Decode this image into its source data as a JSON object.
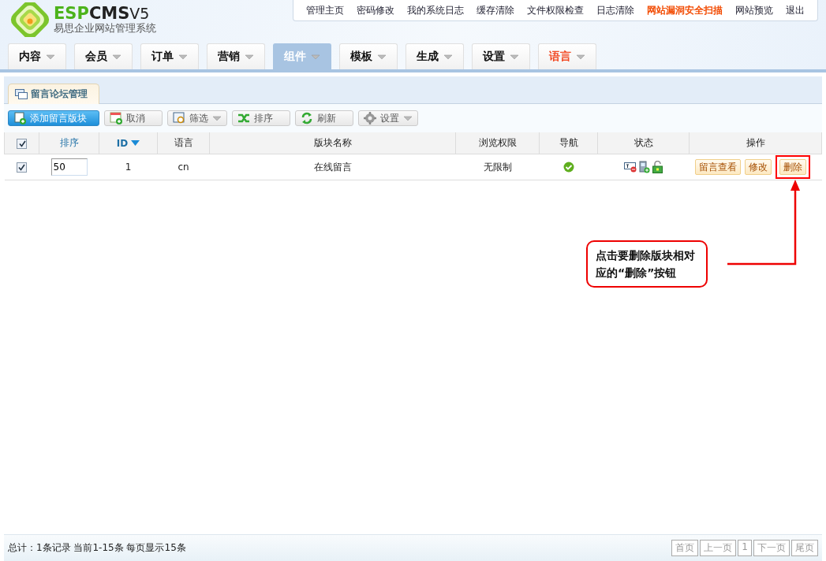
{
  "logo": {
    "brand_prefix": "ESP",
    "brand_name": "CMS",
    "version": "V5",
    "subtitle": "易思企业网站管理系统"
  },
  "top_links": [
    {
      "label": "管理主页",
      "highlight": false
    },
    {
      "label": "密码修改",
      "highlight": false
    },
    {
      "label": "我的系统日志",
      "highlight": false
    },
    {
      "label": "缓存清除",
      "highlight": false
    },
    {
      "label": "文件权限检查",
      "highlight": false
    },
    {
      "label": "日志清除",
      "highlight": false
    },
    {
      "label": "网站漏洞安全扫描",
      "highlight": true
    },
    {
      "label": "网站预览",
      "highlight": false
    },
    {
      "label": "退出",
      "highlight": false
    }
  ],
  "nav_tabs": [
    {
      "label": "内容",
      "selected": false,
      "highlight": false
    },
    {
      "label": "会员",
      "selected": false,
      "highlight": false
    },
    {
      "label": "订单",
      "selected": false,
      "highlight": false
    },
    {
      "label": "营销",
      "selected": false,
      "highlight": false
    },
    {
      "label": "组件",
      "selected": true,
      "highlight": false
    },
    {
      "label": "模板",
      "selected": false,
      "highlight": false
    },
    {
      "label": "生成",
      "selected": false,
      "highlight": false
    },
    {
      "label": "设置",
      "selected": false,
      "highlight": false
    },
    {
      "label": "语言",
      "selected": false,
      "highlight": true
    }
  ],
  "panel_tab": "留言论坛管理",
  "toolbar": [
    {
      "label": "添加留言版块",
      "kind": "primary",
      "dropdown": false
    },
    {
      "label": "取消",
      "kind": "plain",
      "dropdown": false
    },
    {
      "label": "筛选",
      "kind": "plain",
      "dropdown": true
    },
    {
      "label": "排序",
      "kind": "plain",
      "dropdown": false
    },
    {
      "label": "刷新",
      "kind": "plain",
      "dropdown": false
    },
    {
      "label": "设置",
      "kind": "plain",
      "dropdown": true
    }
  ],
  "table": {
    "select_all": {
      "checked": true
    },
    "columns": [
      {
        "label": "排序",
        "link": true,
        "sorted": false
      },
      {
        "label": "ID",
        "link": true,
        "sorted": true
      },
      {
        "label": "语言",
        "link": false,
        "sorted": false
      },
      {
        "label": "版块名称",
        "link": false,
        "sorted": false
      },
      {
        "label": "浏览权限",
        "link": false,
        "sorted": false
      },
      {
        "label": "导航",
        "link": false,
        "sorted": false
      },
      {
        "label": "状态",
        "link": false,
        "sorted": false
      },
      {
        "label": "操作",
        "link": false,
        "sorted": false
      }
    ],
    "rows": [
      {
        "checked": true,
        "order": "50",
        "id": "1",
        "language": "cn",
        "name": "在线留言",
        "access": "无限制",
        "nav_on": true,
        "actions": [
          {
            "label": "留言查看",
            "highlighted": false
          },
          {
            "label": "修改",
            "highlighted": false
          },
          {
            "label": "删除",
            "highlighted": true
          }
        ]
      }
    ]
  },
  "annotation": {
    "text": "点击要删除版块相对应的“删除”按钮"
  },
  "footer": {
    "summary": "总计：1条记录 当前1-15条 每页显示15条",
    "pager": [
      "首页",
      "上一页",
      "1",
      "下一页",
      "尾页"
    ]
  }
}
